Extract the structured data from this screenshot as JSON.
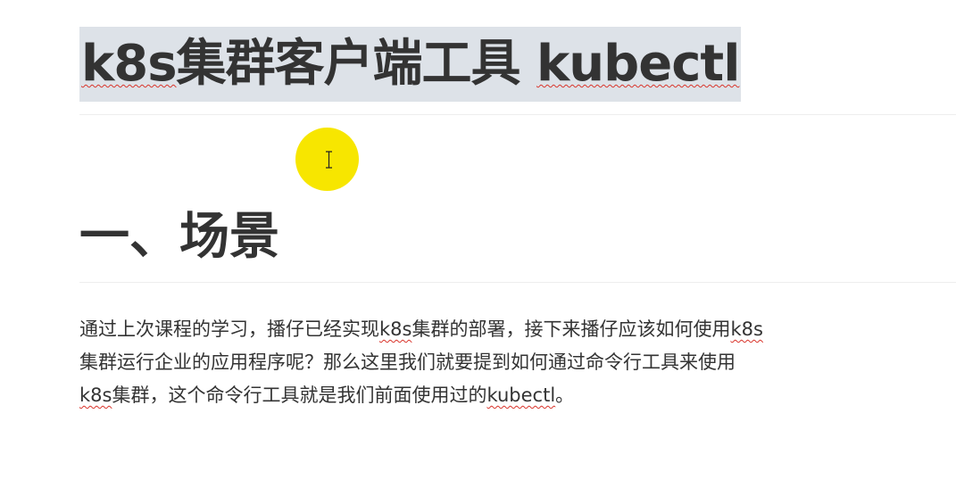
{
  "title": {
    "part1": "k8s",
    "part2": "集群客户端工具 ",
    "part3": "kubectl"
  },
  "section": {
    "heading": "一、场景"
  },
  "paragraph": {
    "line1": {
      "a": "通过上次课程的学习，播仔已经实现",
      "b": "k8s",
      "c": "集群的部署，接下来播仔应该如何使用",
      "d": "k8s"
    },
    "line2": {
      "a": "集群运行企业的应用程序呢？那么这里我们就要提到如何通过命令行工具来使用"
    },
    "line3": {
      "a": "k8s",
      "b": "集群，这个命令行工具就是我们前面使用过的",
      "c": "kubectl",
      "d": "。"
    }
  }
}
